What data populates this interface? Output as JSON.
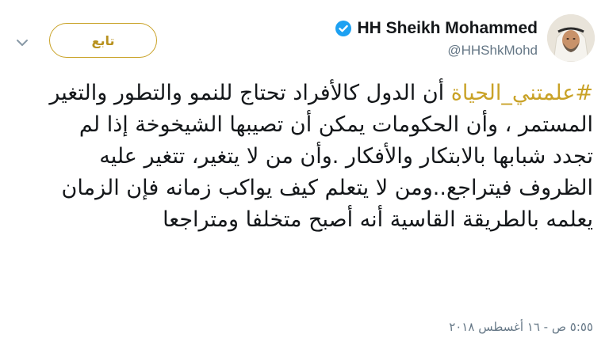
{
  "tweet": {
    "author": {
      "display_name": "HH Sheikh Mohammed",
      "handle": "@HHShkMohd",
      "verified_icon": "verified-badge-icon",
      "avatar_icon": "profile-avatar"
    },
    "follow_button_label": "تابع",
    "menu_icon": "chevron-down-icon",
    "hashtag": "#علمتني_الحياة",
    "body_text": " أن الدول كالأفراد تحتاج للنمو والتطور والتغير المستمر ، وأن الحكومات يمكن أن تصيبها الشيخوخة إذا لم تجدد شبابها بالابتكار والأفكار .وأن من لا يتغير، تتغير عليه الظروف فيتراجع..ومن لا يتعلم كيف يواكب زمانه فإن الزمان يعلمه بالطريقة القاسية أنه أصبح متخلفا ومتراجعا",
    "timestamp": "٥:٥٥ ص - ١٦ أغسطس ٢٠١٨"
  },
  "colors": {
    "accent_gold": "#c9a227",
    "verified_blue": "#1da1f2",
    "text_primary": "#14171a",
    "text_secondary": "#657786"
  }
}
